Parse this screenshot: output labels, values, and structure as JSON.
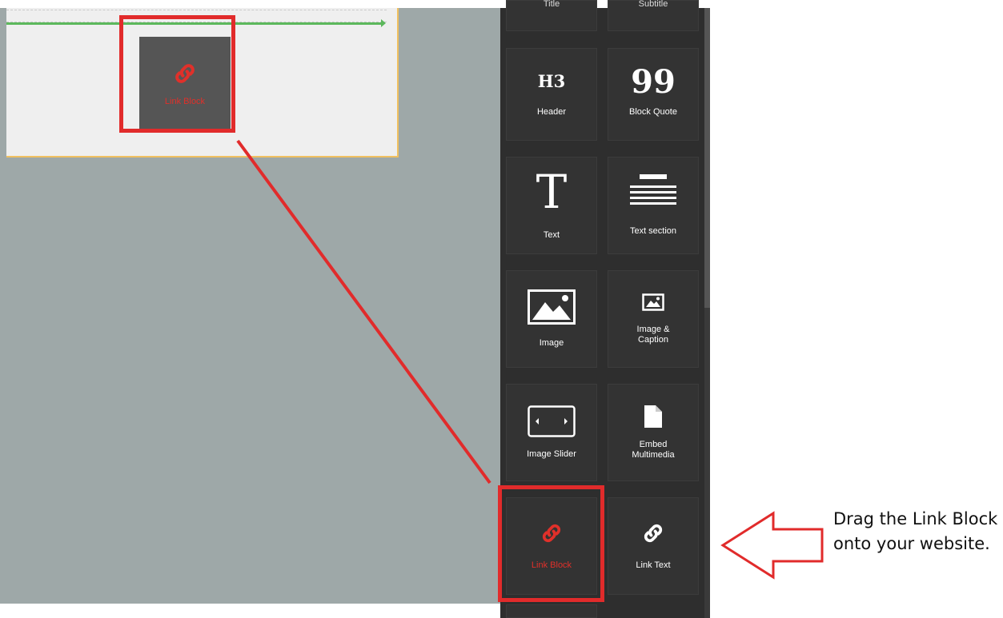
{
  "canvas": {
    "dragged_block": {
      "label": "Link Block",
      "icon": "chain-link-icon"
    }
  },
  "blocks_panel": {
    "tiles": [
      {
        "label": "Title",
        "icon": "none"
      },
      {
        "label": "Subtitle",
        "icon": "none"
      },
      {
        "label": "Header",
        "icon_text": "H3"
      },
      {
        "label": "Block Quote",
        "icon_text": "99"
      },
      {
        "label": "Text",
        "icon_text": "T"
      },
      {
        "label": "Text section",
        "icon": "text-lines-icon"
      },
      {
        "label": "Image",
        "icon": "mountain-image-icon"
      },
      {
        "label": "Image & Caption",
        "icon": "small-image-icon"
      },
      {
        "label": "Image Slider",
        "icon": "slider-arrows-icon"
      },
      {
        "label": "Embed Multimedia",
        "icon": "document-icon"
      },
      {
        "label": "Link Block",
        "icon": "chain-link-icon"
      },
      {
        "label": "Link Text",
        "icon": "chain-link-icon"
      }
    ]
  },
  "annotation": {
    "text": "Drag the Link Block onto your website."
  },
  "colors": {
    "highlight_red": "#e12b2b",
    "drop_indicator_green": "#5cb85c",
    "section_border": "#f0c060"
  }
}
